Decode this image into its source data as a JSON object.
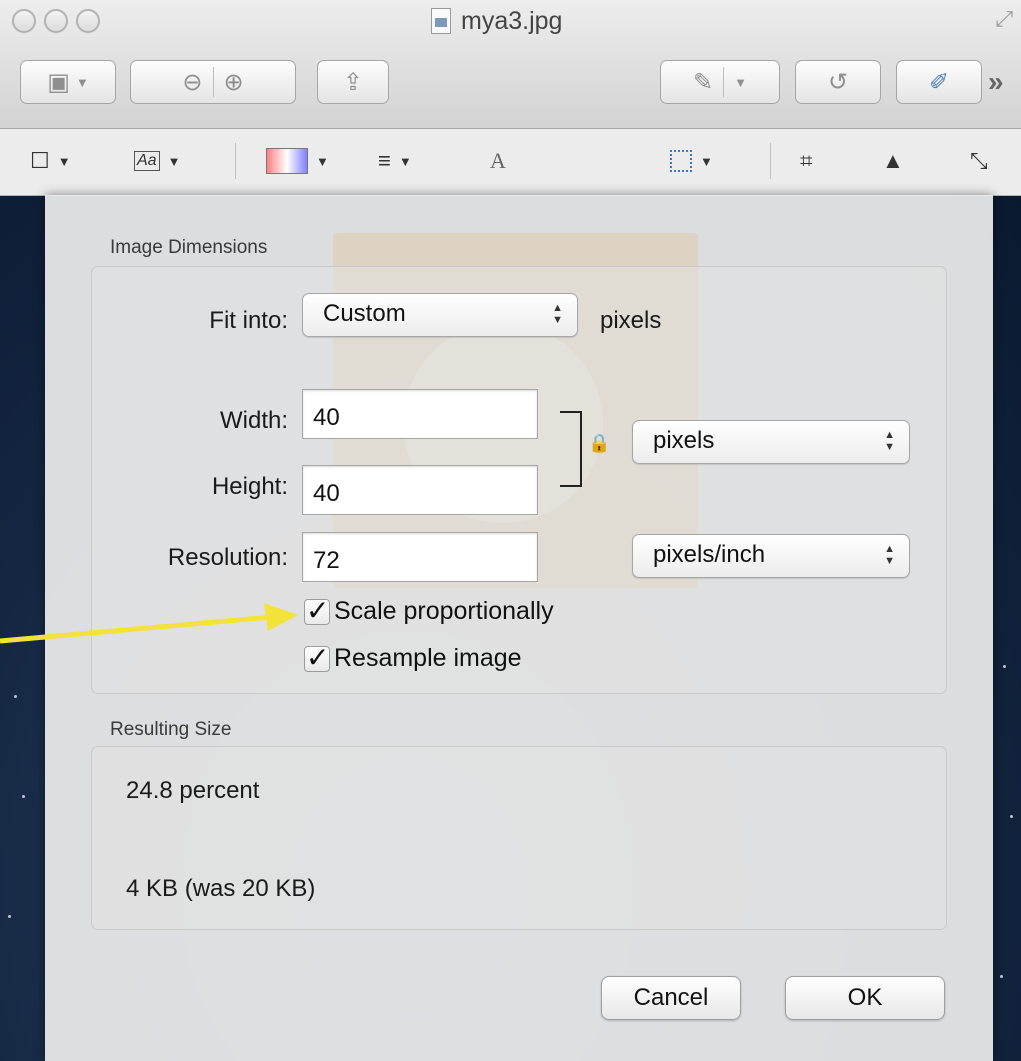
{
  "window": {
    "title": "mya3.jpg"
  },
  "markup_toolbar": {
    "text_tool_glyph": "A"
  },
  "image_dimensions": {
    "section_label": "Image Dimensions",
    "fit_into_label": "Fit into:",
    "fit_into_value": "Custom",
    "fit_into_unit": "pixels",
    "width_label": "Width:",
    "width_value": "40",
    "height_label": "Height:",
    "height_value": "40",
    "size_unit": "pixels",
    "resolution_label": "Resolution:",
    "resolution_value": "72",
    "resolution_unit": "pixels/inch",
    "scale_proportionally_label": "Scale proportionally",
    "scale_proportionally_checked": true,
    "resample_label": "Resample image",
    "resample_checked": true
  },
  "resulting_size": {
    "section_label": "Resulting Size",
    "percent_text": "24.8 percent",
    "size_text": "4 KB (was 20 KB)"
  },
  "buttons": {
    "cancel": "Cancel",
    "ok": "OK"
  },
  "colors": {
    "annotation_arrow": "#f2e23a",
    "desktop_background": "#142641"
  }
}
